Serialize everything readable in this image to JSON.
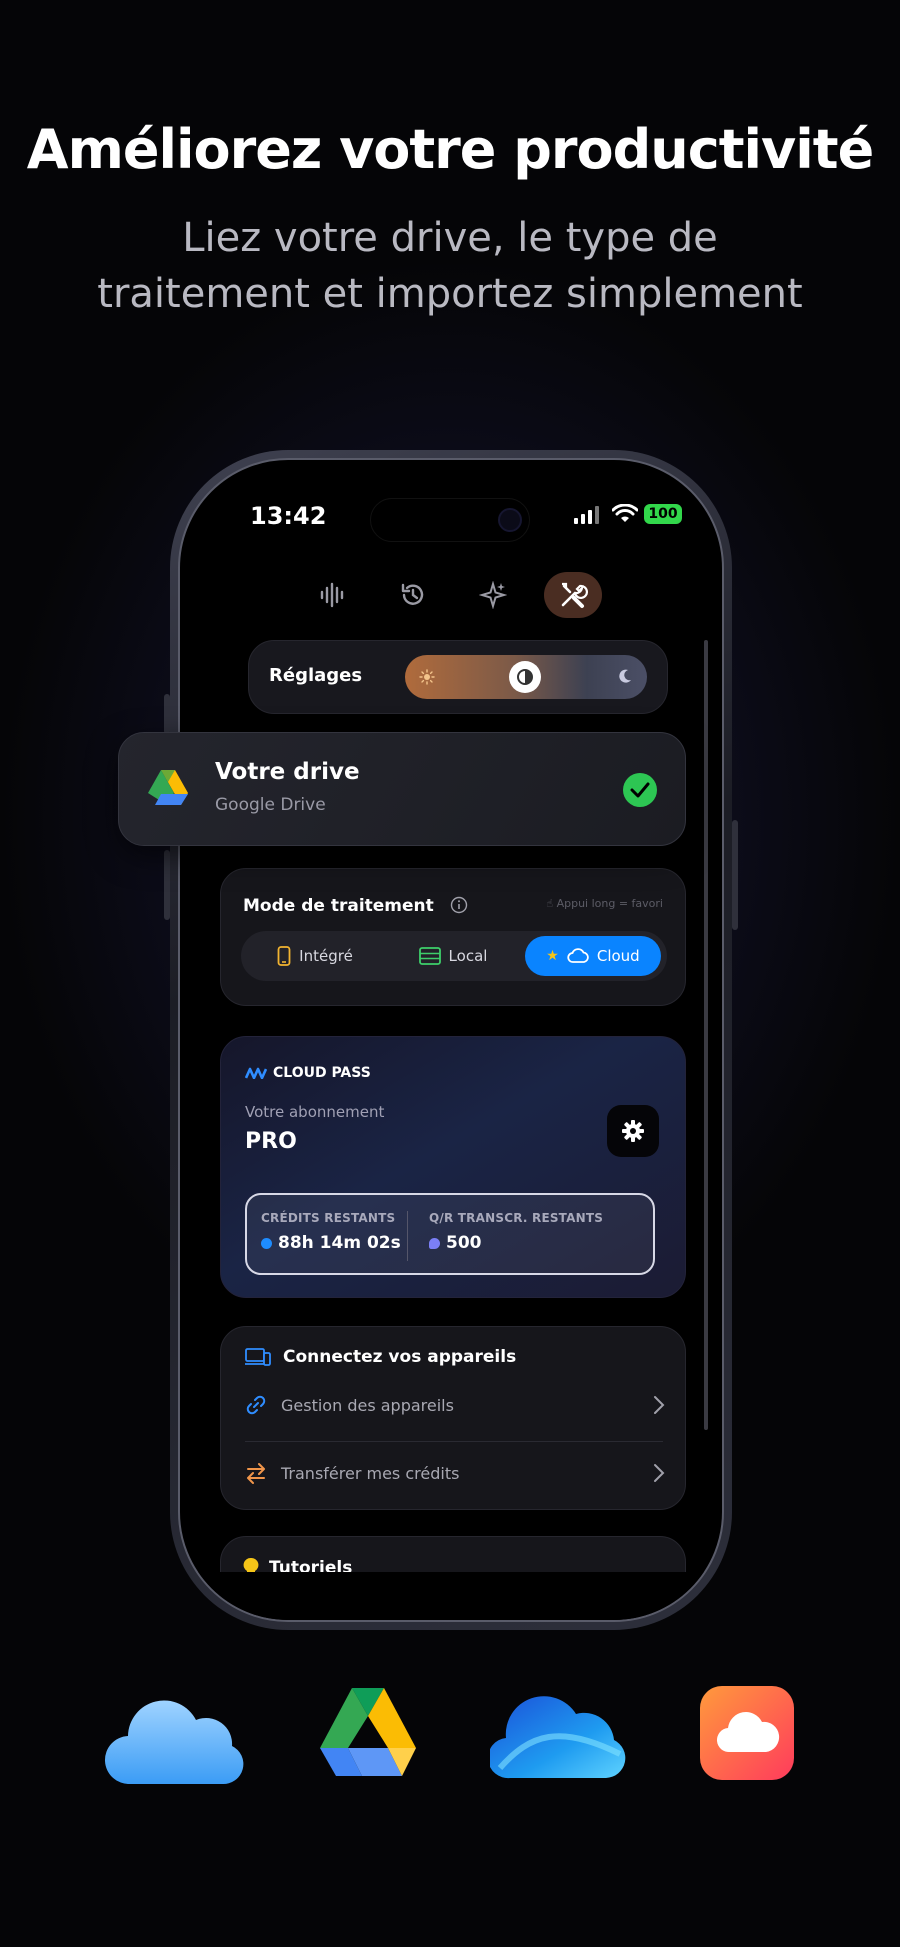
{
  "header": {
    "title": "Améliorez votre productivité",
    "subtitle_line1": "Liez votre drive, le type de",
    "subtitle_line2": "traitement et importez simplement"
  },
  "status_bar": {
    "time": "13:42",
    "battery": "100"
  },
  "top_tabs": [
    {
      "name": "waveform-icon",
      "active": false
    },
    {
      "name": "history-icon",
      "active": false
    },
    {
      "name": "sparkles-icon",
      "active": false
    },
    {
      "name": "tools-icon",
      "active": true
    }
  ],
  "settings": {
    "label": "Réglages"
  },
  "drive": {
    "title": "Votre drive",
    "provider": "Google Drive",
    "connected": true
  },
  "processing_mode": {
    "title": "Mode de traitement",
    "hint": "Appui long = favori",
    "options": [
      {
        "label": "Intégré",
        "active": false
      },
      {
        "label": "Local",
        "active": false
      },
      {
        "label": "Cloud",
        "active": true
      }
    ]
  },
  "cloud_pass": {
    "brand": "CLOUD PASS",
    "subscription_label": "Votre abonnement",
    "tier": "PRO",
    "credits_label": "CRÉDITS RESTANTS",
    "credits_value": "88h 14m 02s",
    "qa_label": "Q/R TRANSCR. RESTANTS",
    "qa_value": "500"
  },
  "devices": {
    "title": "Connectez vos appareils",
    "items": [
      {
        "label": "Gestion des appareils"
      },
      {
        "label": "Transférer mes crédits"
      }
    ]
  },
  "tutorials": {
    "title": "Tutoriels"
  },
  "providers": [
    "icloud-icon",
    "google-drive-icon",
    "onedrive-icon",
    "cloud-app-icon"
  ],
  "colors": {
    "accent_blue": "#0a84ff",
    "success_green": "#2dc653",
    "active_tab_bg": "#4a2d22"
  }
}
